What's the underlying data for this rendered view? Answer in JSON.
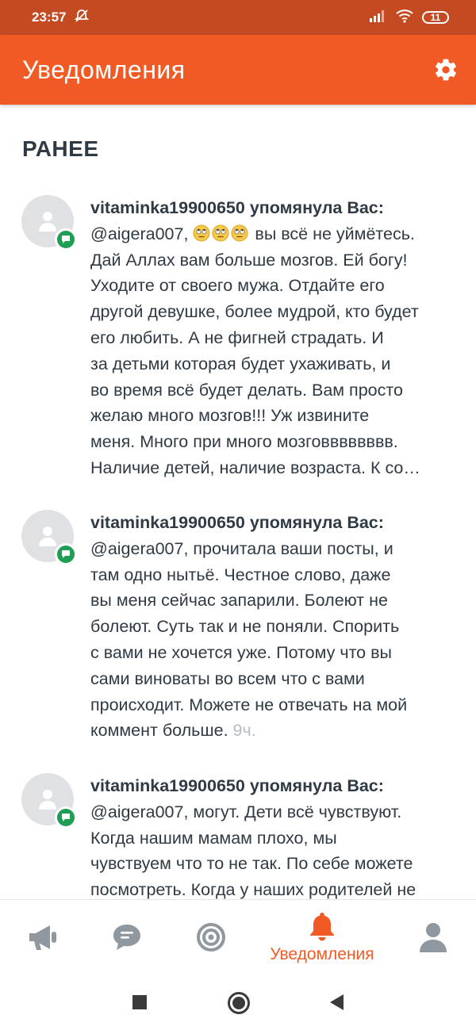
{
  "status_bar": {
    "time": "23:57",
    "battery": "11"
  },
  "app_bar": {
    "title": "Уведомления"
  },
  "section": {
    "title": "РАНЕЕ"
  },
  "notifications": [
    {
      "author": "vitaminka19900650",
      "verb": "упомянула Вас:",
      "lines": [
        "вы всё не уймётесь.",
        "Дай Аллах вам больше мозгов. Ей богу!",
        "Уходите от своего мужа. Отдайте его",
        "другой девушке, более мудрой, кто будет",
        "его любить. А не фигней страдать. И",
        "за детьми которая будет ухаживать, и",
        "во время всё будет делать. Вам просто",
        "желаю много мозгов!!! Уж извините",
        "меня. Много при много мозговввввввв.",
        "Наличие детей, наличие возраста. К со…"
      ],
      "mention": "@aigera007,"
    },
    {
      "author": "vitaminka19900650",
      "verb": "упомянула Вас:",
      "lines": [
        "@aigera007, прочитала ваши посты, и",
        "там одно нытьё. Честное слово, даже",
        "вы меня сейчас запарили. Болеют не",
        "болеют. Суть так и не поняли. Спорить",
        "с вами не хочется уже. Потому что вы",
        "сами виноваты во всем что с вами",
        "происходит. Можете не отвечать на мой",
        "коммент больше."
      ],
      "time": "9ч."
    },
    {
      "author": "vitaminka19900650",
      "verb": "упомянула Вас:",
      "lines": [
        "@aigera007, могут. Дети всё чувствуют.",
        "Когда нашим мамам плохо, мы",
        "чувствуем что то не так. По себе можете",
        "посмотреть. Когда у наших родителей не"
      ]
    }
  ],
  "bottom_nav": {
    "active_label": "Уведомления",
    "items": [
      "announcements-icon",
      "messages-icon",
      "target-icon",
      "bell-icon",
      "profile-icon"
    ]
  },
  "colors": {
    "brand": "#f15a24",
    "status_bar": "#c44a22",
    "badge": "#1f9d55",
    "text": "#2f3a44",
    "muted": "#b6bcc2"
  }
}
